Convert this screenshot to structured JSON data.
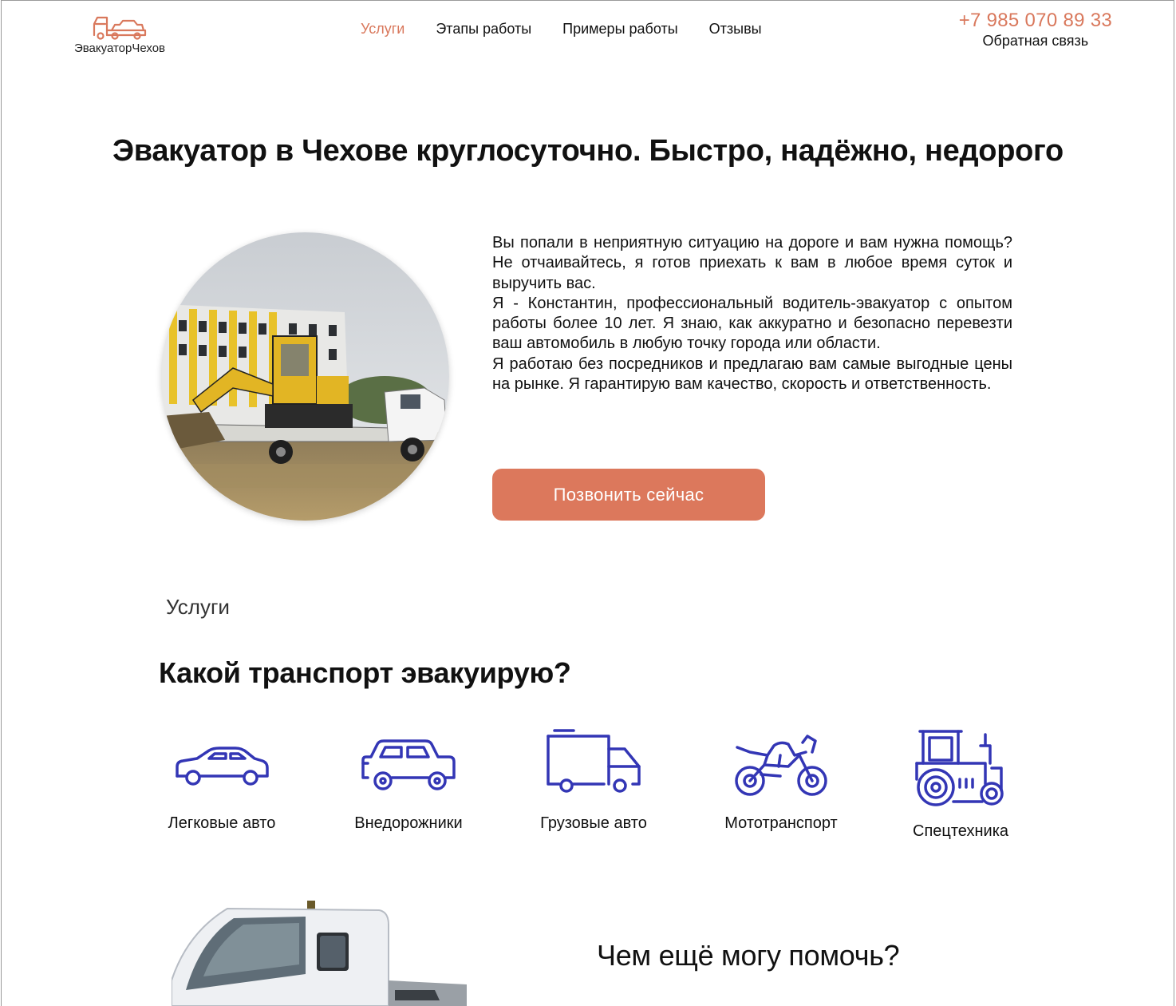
{
  "header": {
    "logo_text": "ЭвакуаторЧехов",
    "nav": [
      {
        "label": "Услуги",
        "active": true
      },
      {
        "label": "Этапы работы",
        "active": false
      },
      {
        "label": "Примеры работы",
        "active": false
      },
      {
        "label": "Отзывы",
        "active": false
      }
    ],
    "phone": "+7 985 070 89 33",
    "feedback": "Обратная связь"
  },
  "hero": {
    "title": "Эвакуатор в Чехове круглосуточно. Быстро, надёжно, недорого",
    "paragraphs": [
      "Вы попали в неприятную ситуацию на дороге и вам нужна помощь? Не отчаивайтесь, я готов приехать к вам в любое время суток и выручить вас.",
      "Я - Константин, профессиональный водитель-эвакуатор с опытом работы более 10 лет. Я знаю, как аккуратно и безопасно перевезти ваш автомобиль в любую точку города или области.",
      "Я работаю без посредников и предлагаю вам самые выгодные цены на рынке. Я гарантирую вам качество, скорость и ответственность."
    ],
    "call_button": "Позвонить сейчас"
  },
  "services": {
    "label": "Услуги",
    "title": "Какой транспорт эвакуирую?",
    "vehicles": [
      {
        "label": "Легковые авто",
        "icon": "sedan-icon"
      },
      {
        "label": "Внедорожники",
        "icon": "suv-icon"
      },
      {
        "label": "Грузовые авто",
        "icon": "truck-icon"
      },
      {
        "label": "Мототранспорт",
        "icon": "motorcycle-icon"
      },
      {
        "label": "Спецтехника",
        "icon": "tractor-icon"
      }
    ]
  },
  "more": {
    "title": "Чем ещё могу помочь?"
  },
  "colors": {
    "accent": "#dc785c",
    "icon_blue": "#3336b5"
  }
}
